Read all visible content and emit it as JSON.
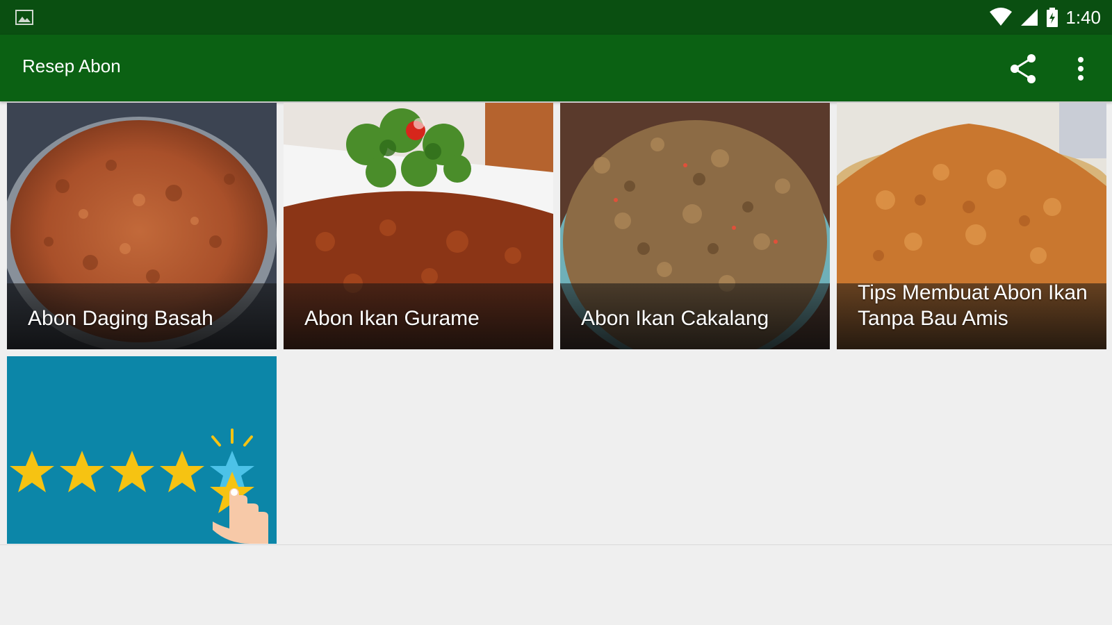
{
  "status_bar": {
    "time": "1:40",
    "left_icon": "image-icon",
    "icons": [
      "wifi-icon",
      "signal-icon",
      "battery-charging-icon"
    ]
  },
  "toolbar": {
    "title": "Resep Abon",
    "share_icon": "share-icon",
    "menu_icon": "more-vert-icon"
  },
  "recipes": [
    {
      "title": "Abon Daging Basah"
    },
    {
      "title": "Abon Ikan Gurame"
    },
    {
      "title": "Abon Ikan Cakalang"
    },
    {
      "title": "Tips Membuat Abon Ikan Tanpa Bau Amis"
    }
  ],
  "rate_tile": {
    "icon": "rate-stars-icon",
    "stars": 5
  },
  "colors": {
    "status_bar": "#0a4f11",
    "toolbar": "#0b6113",
    "background": "#efefef",
    "rate_tile": "#0c86a8",
    "star": "#f6c312"
  }
}
